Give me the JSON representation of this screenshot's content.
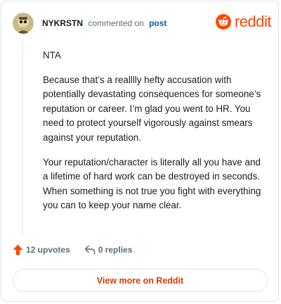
{
  "comment": {
    "username": "NYKRSTN",
    "action_text": "commented on",
    "post_link_label": "post",
    "paragraphs": [
      "NTA",
      "Because that’s a realllly hefty accusation with potentially devastating consequences for someone’s reputation or career. I’m glad you went to HR. You need to protect yourself vigorously against smears against your reputation.",
      "Your reputation/character is literally all you have and a lifetime of hard work can be destroyed in seconds. When something is not true you fight with everything you can to keep your name clear."
    ],
    "upvotes_label": "12 upvotes",
    "replies_label": "0 replies"
  },
  "brand": {
    "name": "reddit",
    "icon": "reddit-snoo-icon",
    "color": "#ff4500"
  },
  "footer": {
    "view_more_label": "View more on Reddit"
  },
  "icons": {
    "avatar": "user-avatar",
    "upvote": "upvote-arrow-icon",
    "reply": "reply-icon"
  },
  "colors": {
    "accent": "#ff4500",
    "link": "#0a5caa",
    "cta": "#d93a00",
    "muted": "#576f76"
  }
}
